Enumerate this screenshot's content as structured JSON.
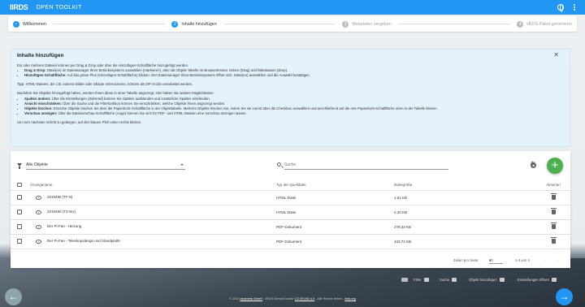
{
  "app": {
    "logo": "IIRDS",
    "title": "OPEN TOOLKIT"
  },
  "stepper": {
    "steps": [
      {
        "num": "✓",
        "label": "Willkommen",
        "state": "done"
      },
      {
        "num": "2",
        "label": "Inhalte hinzufügen",
        "state": "active"
      },
      {
        "num": "3",
        "label": "Metadaten vergeben",
        "state": "todo"
      },
      {
        "num": "4",
        "label": "iiRDS-Paket generieren",
        "state": "todo"
      }
    ]
  },
  "info": {
    "title": "Inhalte hinzufügen",
    "intro": "Ein oder mehrere Dateien können per Drag & Drop oder über die Hinzufügen-Schaltfläche hinzugefügt werden.",
    "add_items": [
      {
        "bold": "Drag & Drop:",
        "text": " Datei(en) im Dateimanager Ihres Betriebssystems auswählen (markieren), über die Objekt-Tabelle im Browserfenster ziehen (Drag) und fallenlassen (Drop)."
      },
      {
        "bold": "Hinzufügen-Schaltfläche:",
        "text": " Auf das grüne Plus (Hinzufügen-Schaltfläche) klicken. Der Dateimanager Ihres Betriebssystems öffnet sich. Datei(en) auswählen und die Auswahl bestätigen."
      }
    ],
    "tip": "Tipp: HTML-Dateien, die z.B. externe Bilder oder Skripte referenzieren, können als ZIP-Archiv verarbeitet werden.",
    "after": "Nachdem Sie Objekte hinzugefügt haben, werden Ihnen diese in einer Tabelle angezeigt. Hier haben Sie weitere Möglichkeiten:",
    "options": [
      {
        "bold": "Spalten ändern:",
        "text": " Über die Einstellungen (Zahnrad) können Sie Spalten ausblenden und zusätzliche Spalten einblenden."
      },
      {
        "bold": "Ansicht einschränken:",
        "text": " Über die Suche und die Filterfunktion können Sie einschränken, welche Objekte Ihnen angezeigt werden."
      },
      {
        "bold": "Objekte löschen:",
        "text": " Einzelne Objekte löschen Sie über die Papierkorb-Schaltfläche in der Objekttabelle. Mehrere Objekte löschen Sie, indem Sie sie zuerst über die Checkbox auswählen und anschließend auf die rote Papierkorb-Schaltfläche oben in der Tabelle klicken."
      },
      {
        "bold": "Vorschau anzeigen:",
        "text": " Über die Dateivorschau-Schaltfläche (Auge) können Sie sich für PDF- und HTML-Dateien eine Vorschau anzeigen lassen."
      }
    ],
    "next": "Um zum nächsten Schritt zu gelangen, auf den blauen Pfeil unten rechts klicken."
  },
  "toolbar": {
    "filter_value": "Alle Objekte",
    "search_placeholder": "Suche",
    "add_icon": "+"
  },
  "table": {
    "headers": {
      "name": "Anzeigename",
      "type": "Typ der Quelldatei",
      "size": "Dateigröße",
      "actions": "Aktionen"
    },
    "rows": [
      {
        "name": "2019490 (TF-8)",
        "type": "HTML-Datei",
        "size": "1,61 KB"
      },
      {
        "name": "2019490 (T3-W1)",
        "type": "HTML-Datei",
        "size": "2,30 KB"
      },
      {
        "name": "Der Pi-Fan - Heizung",
        "type": "PDF-Dokument",
        "size": "278,33 KB"
      },
      {
        "name": "Der Pi-Fan - Teleskopstange und Standplatte",
        "type": "PDF-Dokument",
        "size": "433,72 KB"
      }
    ]
  },
  "pager": {
    "label": "Zeilen pro Seite:",
    "per_page": "10",
    "range": "1-4 von 4"
  },
  "shortcuts": [
    {
      "label": "Filter",
      "key": "F"
    },
    {
      "label": "Suche",
      "key": "S"
    },
    {
      "label": "Objekt hinzufügen",
      "key": "A"
    },
    {
      "label": "Einstellungen öffnen",
      "key": "E"
    }
  ],
  "footer": {
    "prefix": "© 2020 ",
    "link1": "plusmeta GmbH",
    "mid": " - iiRDS licensed under ",
    "link2": "CC BY-ND 4.0",
    "mid2": " - Alle Rechte lieben - ",
    "link3": "iirds.org"
  }
}
